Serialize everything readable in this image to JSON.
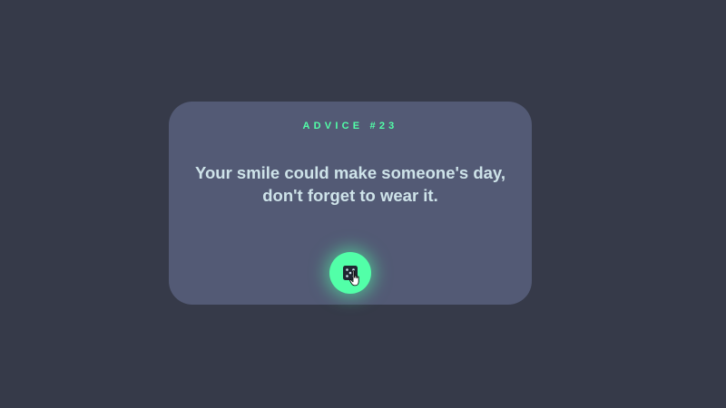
{
  "card": {
    "label": "ADVICE #23",
    "quote": "Your smile could make someone's day, don't forget to wear it."
  },
  "button": {
    "icon": "dice-icon",
    "action": "generate-advice"
  },
  "colors": {
    "background": "#363a49",
    "card": "#535a75",
    "accent": "#52ffa8",
    "text": "#cee3e9"
  }
}
